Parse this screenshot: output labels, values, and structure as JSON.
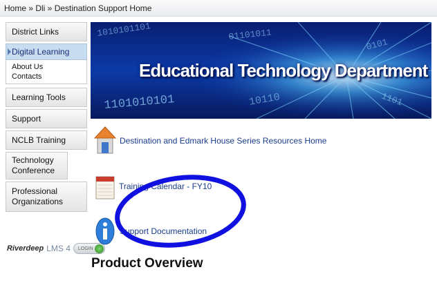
{
  "breadcrumb": {
    "text": "Home » Dli » Destination Support Home"
  },
  "sidebar": {
    "items": [
      {
        "label": "District Links"
      },
      {
        "label": "Digital Learning",
        "sub": [
          "About Us",
          "Contacts"
        ]
      },
      {
        "label": "Learning Tools"
      },
      {
        "label": "Support"
      },
      {
        "label": "NCLB Training"
      },
      {
        "label": "Technology Conference"
      },
      {
        "label": "Professional Organizations"
      }
    ],
    "logo": {
      "brand": "Riverdeep",
      "product": "LMS 4",
      "button": "LOGIN"
    }
  },
  "banner": {
    "title": "Educational Technology Department",
    "colors": {
      "bg": "#0b2a8c",
      "accent": "#1fb8ff"
    }
  },
  "links": [
    {
      "icon": "house-icon",
      "label": "Destination and Edmark House Series Resources Home"
    },
    {
      "icon": "calendar-icon",
      "label": "Training Calendar - FY10"
    },
    {
      "icon": "info-icon",
      "label": "Support Documentation"
    }
  ],
  "main": {
    "heading": "Product Overview"
  },
  "annotation": {
    "color": "#1010e0"
  }
}
